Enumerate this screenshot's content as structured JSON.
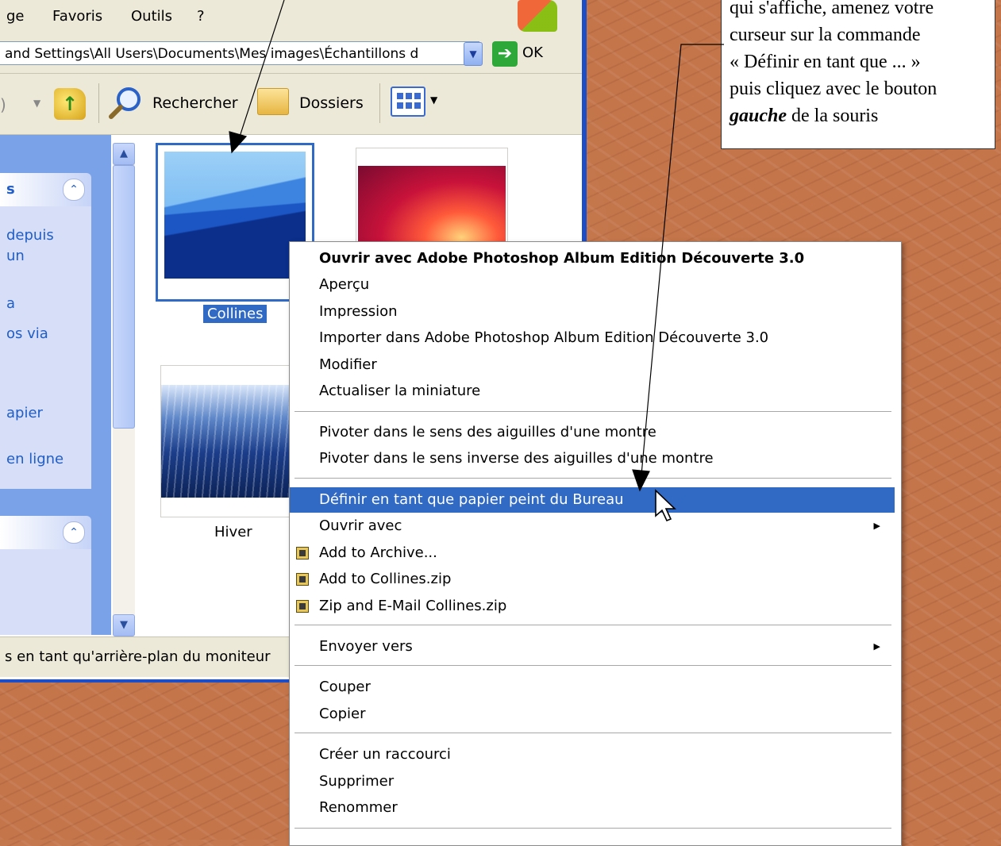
{
  "menubar": {
    "items": [
      "ge",
      "Favoris",
      "Outils",
      "?"
    ]
  },
  "address": {
    "path": "and Settings\\All Users\\Documents\\Mes images\\Échantillons d",
    "go_label": "OK"
  },
  "toolbar": {
    "search_label": "Rechercher",
    "folders_label": "Dossiers"
  },
  "taskpane": {
    "section1_title": "s",
    "section1_links": [
      "depuis",
      "un",
      "a",
      "os via",
      "apier",
      "en ligne"
    ],
    "section2_title": ""
  },
  "thumbnails": [
    {
      "label": "Collines",
      "selected": true
    },
    {
      "label": "",
      "selected": false
    },
    {
      "label": "Hiver",
      "selected": false
    }
  ],
  "statusbar": {
    "text": "s en tant qu'arrière-plan du moniteur"
  },
  "context_menu": {
    "group1": [
      "Ouvrir avec Adobe Photoshop Album Edition Découverte 3.0",
      "Aperçu",
      "Impression",
      "Importer dans Adobe Photoshop Album Edition Découverte 3.0",
      "Modifier",
      "Actualiser la miniature"
    ],
    "group2": [
      "Pivoter dans le sens des aiguilles d'une montre",
      "Pivoter dans le sens inverse des aiguilles d'une montre"
    ],
    "group3": [
      "Définir en tant que papier peint du Bureau",
      "Ouvrir avec",
      "Add to Archive...",
      "Add to Collines.zip",
      "Zip and E-Mail Collines.zip"
    ],
    "group4": [
      "Envoyer vers"
    ],
    "group5": [
      "Couper",
      "Copier"
    ],
    "group6": [
      "Créer un raccourci",
      "Supprimer",
      "Renommer"
    ],
    "selected_item": "Définir en tant que papier peint du Bureau"
  },
  "callout": {
    "line1": "qui s'affiche, amenez votre",
    "line2": "curseur sur la commande",
    "line3": "« Définir en tant que ... »",
    "line4": "puis cliquez avec le bouton",
    "bold_word": "gauche",
    "line5_rest": " de la souris"
  },
  "colors": {
    "selection": "#316ac5",
    "window_border": "#1c4ec8",
    "taskpane": "#7aa2e9",
    "desktop": "#c4754a"
  }
}
